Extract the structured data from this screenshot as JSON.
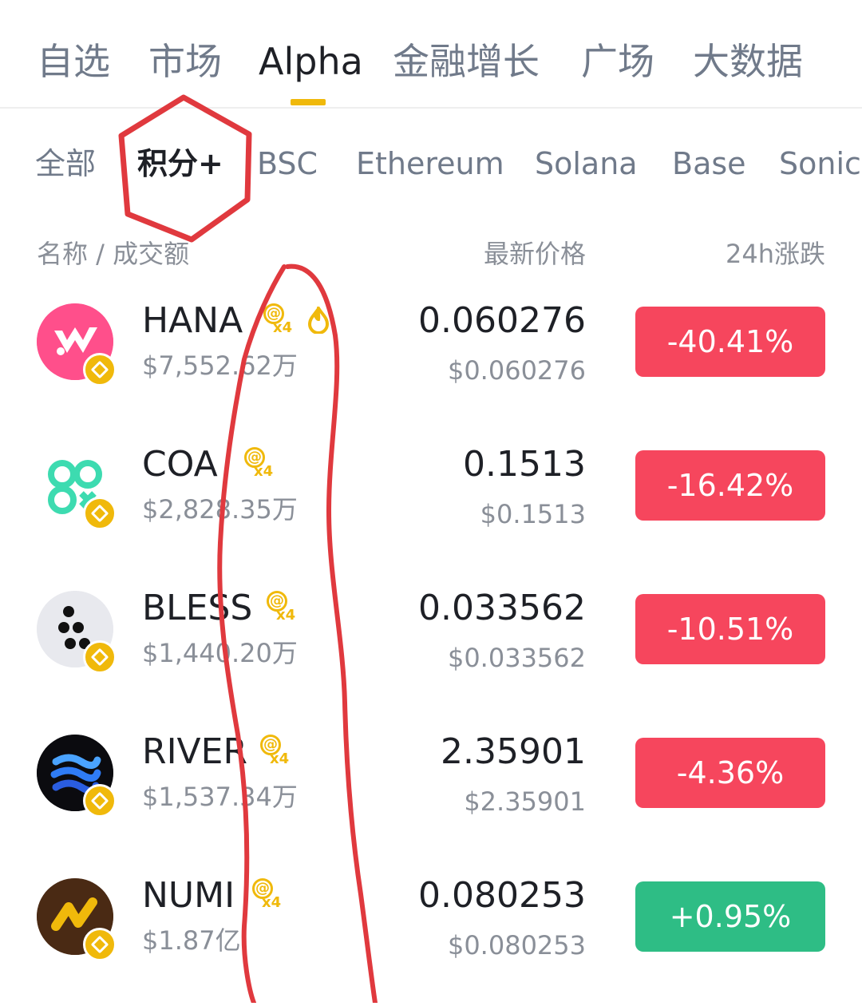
{
  "top_tabs": [
    {
      "label": "自选"
    },
    {
      "label": "市场"
    },
    {
      "label": "Alpha",
      "active": true
    },
    {
      "label": "金融增长"
    },
    {
      "label": "广场"
    },
    {
      "label": "大数据"
    }
  ],
  "chain_tabs": [
    {
      "label": "全部"
    },
    {
      "label": "积分+",
      "active": true
    },
    {
      "label": "BSC"
    },
    {
      "label": "Ethereum"
    },
    {
      "label": "Solana"
    },
    {
      "label": "Base"
    },
    {
      "label": "Sonic"
    }
  ],
  "columns": {
    "name": "名称 / 成交额",
    "price": "最新价格",
    "change": "24h涨跌"
  },
  "points_badge": {
    "symbol": "@",
    "multiplier": "x4"
  },
  "tokens": [
    {
      "symbol": "HANA",
      "volume": "$7,552.62万",
      "price": "0.060276",
      "fiat": "$0.060276",
      "change": "-40.41%",
      "direction": "down",
      "logo_color": "#ff4f8b"
    },
    {
      "symbol": "COA",
      "volume": "$2,828.35万",
      "price": "0.1513",
      "fiat": "$0.1513",
      "change": "-16.42%",
      "direction": "down",
      "logo_color": "#3ddbb0"
    },
    {
      "symbol": "BLESS",
      "volume": "$1,440.20万",
      "price": "0.033562",
      "fiat": "$0.033562",
      "change": "-10.51%",
      "direction": "down",
      "logo_color": "#e8e9ee"
    },
    {
      "symbol": "RIVER",
      "volume": "$1,537.34万",
      "price": "2.35901",
      "fiat": "$2.35901",
      "change": "-4.36%",
      "direction": "down",
      "logo_color": "#0b0b0f"
    },
    {
      "symbol": "NUMI",
      "volume": "$1.87亿",
      "price": "0.080253",
      "fiat": "$0.080253",
      "change": "+0.95%",
      "direction": "up",
      "logo_color": "#4a2a14"
    }
  ],
  "colors": {
    "accent": "#f0b90b",
    "down": "#f6465d",
    "up": "#2ebd85",
    "annotation": "#e0393e"
  }
}
